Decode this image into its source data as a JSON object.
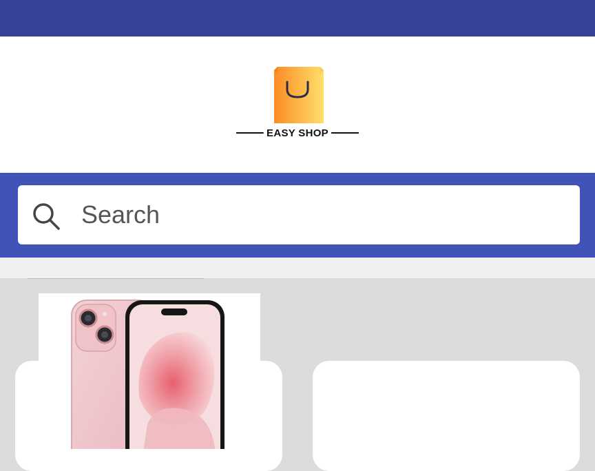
{
  "status_bar": {
    "color": "#354297"
  },
  "header": {
    "logo": {
      "text": "EASY SHOP",
      "icon": "shopping-bag-icon"
    }
  },
  "search": {
    "placeholder": "Search",
    "icon": "search-icon",
    "band_color": "#4253b8"
  },
  "products": [
    {
      "image": "pink-phone-image"
    },
    {
      "image": ""
    }
  ],
  "colors": {
    "bag_gradient_start": "#fb8c23",
    "bag_gradient_end": "#ffdf6b",
    "background": "#dcdcdc"
  }
}
